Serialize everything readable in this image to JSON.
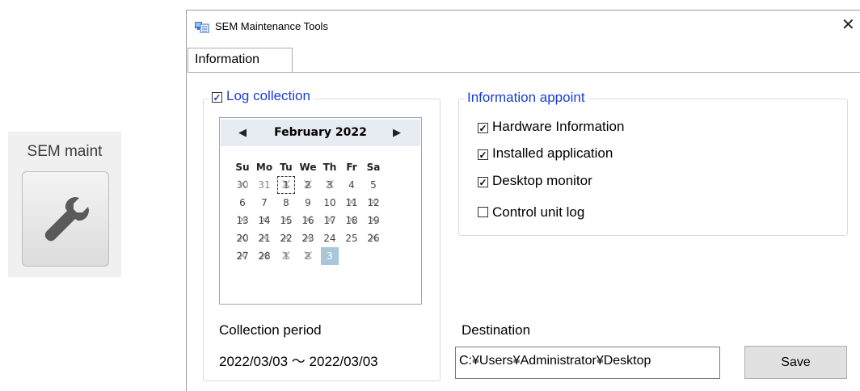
{
  "launcher": {
    "label": "SEM maint",
    "icon": "wrench-icon"
  },
  "window": {
    "title": "SEM Maintenance Tools",
    "close_glyph": "✕",
    "tab": "Information"
  },
  "log_collection": {
    "label": "Log collection",
    "checked": true,
    "calendar": {
      "month": "February 2022",
      "weekdays": [
        "Su",
        "Mo",
        "Tu",
        "We",
        "Th",
        "Fr",
        "Sa"
      ],
      "rows": [
        [
          "30",
          "31",
          "1",
          "2",
          "3",
          "4",
          "5"
        ],
        [
          "6",
          "7",
          "8",
          "9",
          "10",
          "11",
          "12"
        ],
        [
          "13",
          "14",
          "15",
          "16",
          "17",
          "18",
          "19"
        ],
        [
          "20",
          "21",
          "22",
          "23",
          "24",
          "25",
          "26"
        ],
        [
          "27",
          "28",
          "1",
          "2",
          "3",
          "",
          ""
        ]
      ]
    },
    "period_label": "Collection period",
    "period_value": "2022/03/03 ～ 2022/03/03"
  },
  "information_appoint": {
    "label": "Information appoint",
    "options": [
      {
        "label": "Hardware Information",
        "checked": true
      },
      {
        "label": "Installed application",
        "checked": true
      },
      {
        "label": "Desktop monitor",
        "checked": true
      },
      {
        "label": "Control unit log",
        "checked": false
      }
    ]
  },
  "destination": {
    "label": "Destination",
    "value": "C:¥Users¥Administrator¥Desktop",
    "save_label": "Save"
  },
  "colors": {
    "accent": "#1a3cd6",
    "today": "#a9c7d8"
  }
}
